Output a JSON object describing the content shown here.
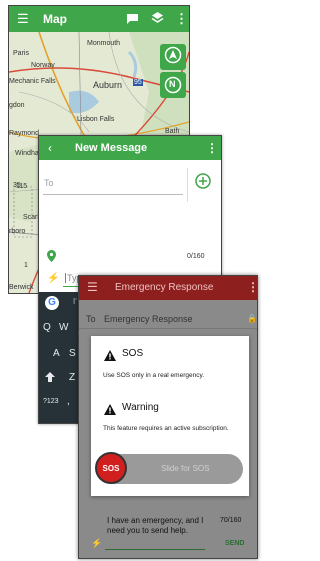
{
  "map_screen": {
    "title": "Map",
    "places": [
      {
        "name": "Monmouth"
      },
      {
        "name": "Norway"
      },
      {
        "name": "Auburn"
      },
      {
        "name": "Mechanic Falls"
      },
      {
        "name": "Lisbon Falls"
      },
      {
        "name": "gdon"
      },
      {
        "name": "Raymond"
      },
      {
        "name": "Windha"
      },
      {
        "name": "Bath"
      },
      {
        "name": "Scarb"
      },
      {
        "name": "rboro"
      },
      {
        "name": "Berwick"
      },
      {
        "name": "Paris"
      },
      {
        "name": "35"
      },
      {
        "name": "95"
      },
      {
        "name": "115"
      },
      {
        "name": "1"
      }
    ],
    "compass_label": "N"
  },
  "message_screen": {
    "title": "New Message",
    "to_placeholder": "To",
    "char_count": "0/160",
    "type_text": "Typ",
    "keys_row1": [
      "Q",
      "W"
    ],
    "keys_row2": [
      "A",
      "S"
    ],
    "keys_row3": [
      "Z"
    ],
    "key_123": "?123",
    "key_comma": ",",
    "google_label": "G",
    "suggestion_fragment": "I'"
  },
  "emergency_screen": {
    "title": "Emergency Response",
    "to_label": "To",
    "to_value": "Emergency Response",
    "sos_heading": "SOS",
    "sos_body": "Use SOS only in a real emergency.",
    "warning_heading": "Warning",
    "warning_body": "This feature requires an active subscription.",
    "sos_button": "SOS",
    "slide_text": "Slide for SOS",
    "message_text": "I have an emergency, and I need you to send help.",
    "char_count": "70/160",
    "send_label": "SEND"
  },
  "colors": {
    "green": "#3fa64a",
    "dark_red": "#8d1f1f",
    "sos_red": "#d11f1f"
  }
}
